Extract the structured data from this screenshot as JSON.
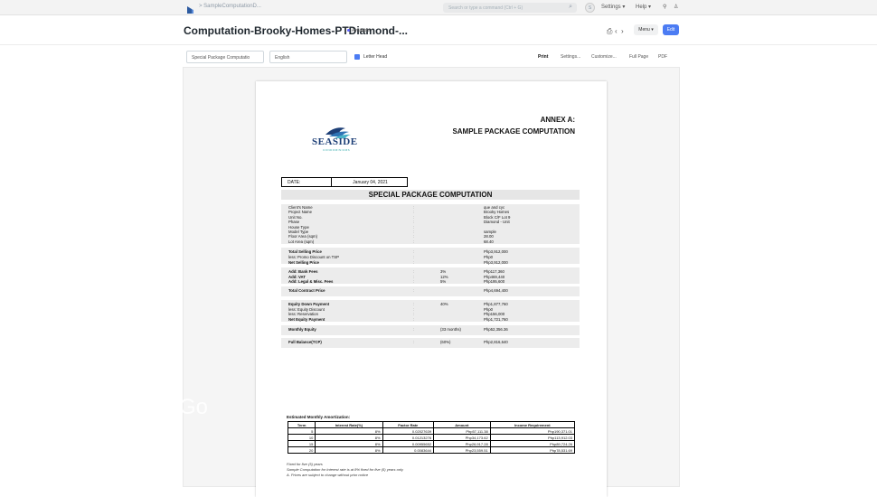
{
  "topbar": {
    "breadcrumb": "> SampleComputationD...",
    "search_placeholder": "Search or type a command (Ctrl + G)",
    "avatar": "S",
    "settings": "Settings ▾",
    "help": "Help ▾"
  },
  "header": {
    "title": "Computation-Brooky-Homes-PTDiamond-...",
    "status": "Available",
    "menu_label": "Menu ▾",
    "edit_label": "Edit"
  },
  "toolbar": {
    "print_format": "Special Package Computatio",
    "language": "English",
    "letterhead_label": "Letter Head",
    "print": "Print",
    "settings": "Settings...",
    "customize": "Customize...",
    "full_page": "Full Page",
    "pdf": "PDF"
  },
  "doc": {
    "annex": "ANNEX A:",
    "subtitle": "SAMPLE PACKAGE COMPUTATION",
    "brand_name": "SEASIDE",
    "brand_sub": "CONDOMINIUMS",
    "date_label": "DATE:",
    "date_value": "January 04, 2021",
    "heading": "SPECIAL PACKAGE COMPUTATION",
    "colon": ":",
    "rows_info": [
      {
        "label": "Client's Name",
        "value": "que and cyc"
      },
      {
        "label": "Project Name",
        "value": "Brooky Homes"
      },
      {
        "label": "Unit No.",
        "value": "Block C/F Lot 9"
      },
      {
        "label": "Phase",
        "value": "Diamond - Unit"
      },
      {
        "label": "House Type",
        "value": ""
      },
      {
        "label": "Model Type",
        "value": "sample"
      },
      {
        "label": "Floor Area (sqm)",
        "value": "28.00"
      },
      {
        "label": "Lot Area (sqm)",
        "value": "68.40"
      }
    ],
    "rows_price": [
      {
        "label": "Total Selling Price",
        "value": "Php3,912,000",
        "bold": true
      },
      {
        "label": "less: Promo Discount on TSP",
        "value": "Php0",
        "bold": false
      },
      {
        "label": "Net Selling Price",
        "value": "Php3,912,000",
        "bold": true
      }
    ],
    "rows_fees": [
      {
        "label": "Add: Bank Fees",
        "pct": "3%",
        "value": "Php117,360"
      },
      {
        "label": "Add: VAT",
        "pct": "12%",
        "value": "Php469,440"
      },
      {
        "label": "Add: Legal & Misc. Fees",
        "pct": "5%",
        "value": "Php195,600"
      }
    ],
    "tcp": {
      "label": "Total Contract Price",
      "value": "Php4,694,400"
    },
    "rows_equity": [
      {
        "label": "Equity Down Payment",
        "pct": "40%",
        "value": "Php1,877,760",
        "bold": true
      },
      {
        "label": "less: Equity Discount",
        "pct": "",
        "value": "Php0",
        "bold": false
      },
      {
        "label": "less: Reservation",
        "pct": "",
        "value": "Php156,000",
        "bold": false
      },
      {
        "label": "Net Equity Payment",
        "pct": "",
        "value": "Php1,721,760",
        "bold": true
      }
    ],
    "monthly": {
      "label": "Monthly Equity",
      "pct": "(33 months)",
      "value": "Php52,356.36"
    },
    "balance": {
      "label": "Full Balance(TCP)",
      "pct": "(60%)",
      "value": "Php2,816,640"
    },
    "amort_title": "Estimated Monthly Amortization:",
    "amort_headers": [
      "Term",
      "Interest Rate(%)",
      "Factor Rate",
      "Amount",
      "Income Requirement"
    ],
    "amort_rows": [
      [
        "5",
        "8%",
        "0.02027639",
        "Php57,111.38",
        "Php190,371.01"
      ],
      [
        "10",
        "8%",
        "0.01213276",
        "Php34,173.62",
        "Php113,912.03"
      ],
      [
        "15",
        "8%",
        "0.00955652",
        "Php26,917.28",
        "Php89,724.26"
      ],
      [
        "20",
        "8%",
        "0.0083644",
        "Php23,559.51",
        "Php78,531.69"
      ]
    ],
    "notes": [
      "Fixed for five (5) years",
      "Sample Computation for Interest rate is at 8% fixed for five (5) years only",
      "A. Prices are subject to change without prior notice"
    ]
  },
  "overlay_text": "Go",
  "colors": {
    "accent": "#4c7cf3",
    "brand": "#1d3f77"
  }
}
